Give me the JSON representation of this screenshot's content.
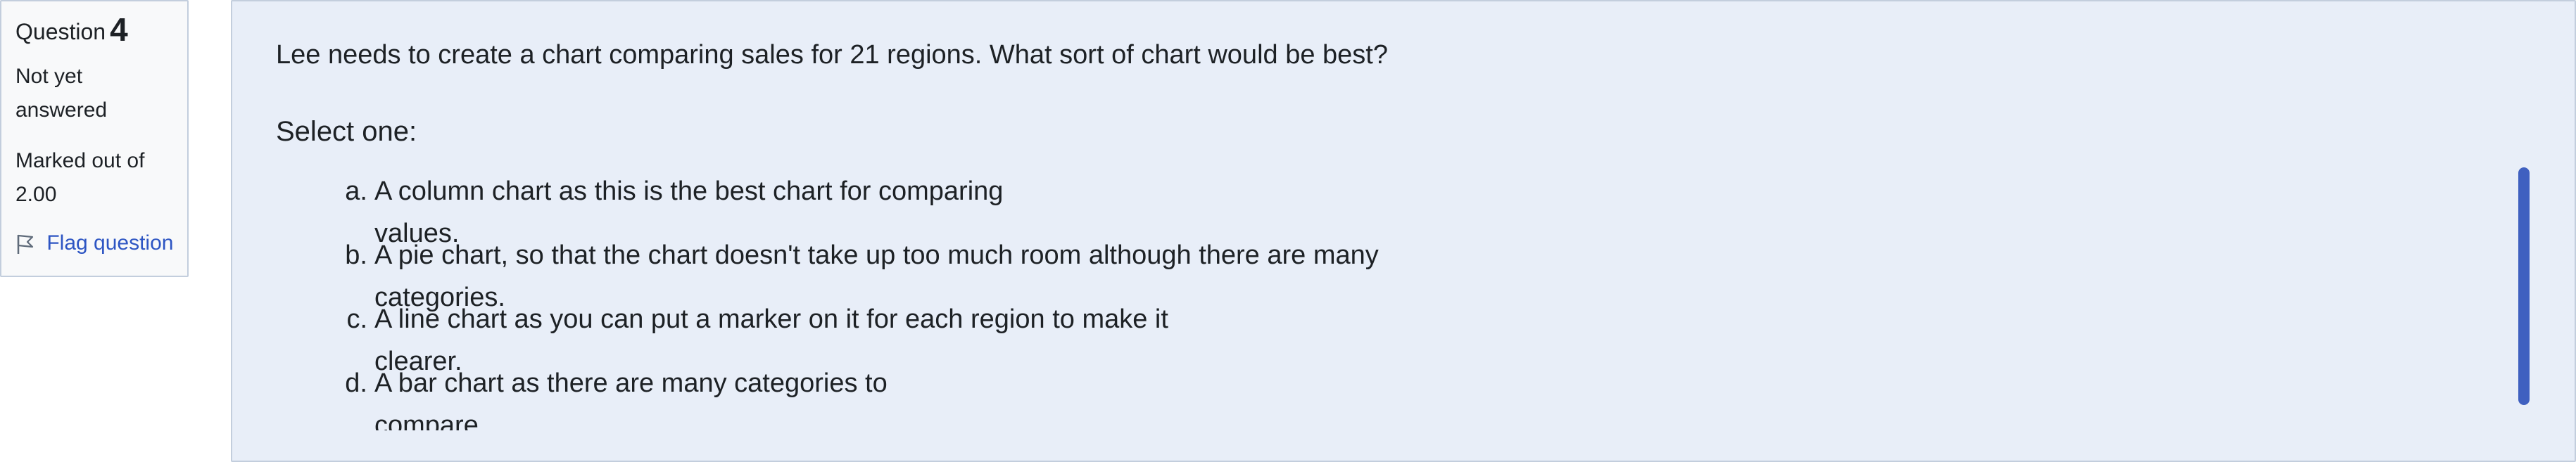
{
  "info": {
    "question_label": "Question",
    "question_number": "4",
    "state": "Not yet answered",
    "grade": "Marked out of 2.00",
    "flag_label": "Flag question",
    "flag_icon": "flag-icon"
  },
  "question": {
    "text": "Lee needs to create a chart comparing sales for 21 regions. What sort of chart would be best?",
    "prompt": "Select one:",
    "options": [
      {
        "letter": "a.",
        "text": "A column chart as this is the best chart for comparing values."
      },
      {
        "letter": "b.",
        "text": "A pie chart, so that the chart doesn't take up too much room although there are many categories."
      },
      {
        "letter": "c.",
        "text": "A line chart as you can put a marker on it for each region to make it clearer."
      },
      {
        "letter": "d.",
        "text": "A bar chart as there are many categories to compare."
      }
    ]
  },
  "colors": {
    "panel_bg": "#f8f9fa",
    "content_bg": "#e8eef8",
    "border": "#c3cedd",
    "link": "#2d55c3",
    "scrollbar": "#3f60c0"
  }
}
